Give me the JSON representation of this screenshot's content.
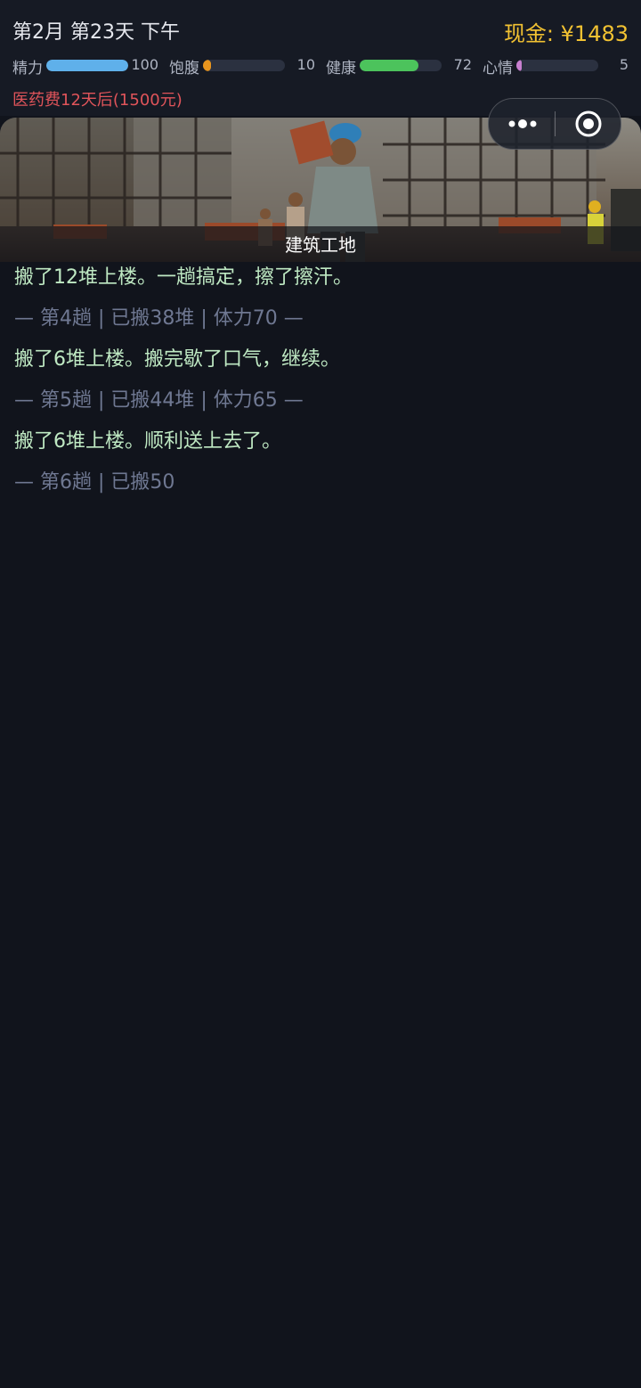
{
  "header": {
    "date": "第2月 第23天 下午",
    "cash": "现金: ¥1483"
  },
  "stats": [
    {
      "label": "精力",
      "value": "100",
      "fraction": 1.0,
      "color": "#5fb0ea"
    },
    {
      "label": "饱腹",
      "value": "10",
      "fraction": 0.1,
      "color": "#e8951e"
    },
    {
      "label": "健康",
      "value": "72",
      "fraction": 0.72,
      "color": "#4cc35c"
    },
    {
      "label": "心情",
      "value": "5",
      "fraction": 0.05,
      "color": "#c77fcf"
    }
  ],
  "medical_notice": "医药费12天后(1500元)",
  "banner": {
    "caption": "建筑工地"
  },
  "log": [
    {
      "type": "event",
      "text": "搬了12堆上楼。一趟搞定，擦了擦汗。"
    },
    {
      "type": "meta",
      "text": "— 第4趟 | 已搬38堆 | 体力70 —"
    },
    {
      "type": "event",
      "text": "搬了6堆上楼。搬完歇了口气，继续。"
    },
    {
      "type": "meta",
      "text": "— 第5趟 | 已搬44堆 | 体力65 —"
    },
    {
      "type": "event",
      "text": "搬了6堆上楼。顺利送上去了。"
    },
    {
      "type": "meta",
      "text": "— 第6趟 | 已搬50"
    }
  ],
  "icons": {
    "more": "more-dots-icon",
    "target": "target-icon"
  }
}
